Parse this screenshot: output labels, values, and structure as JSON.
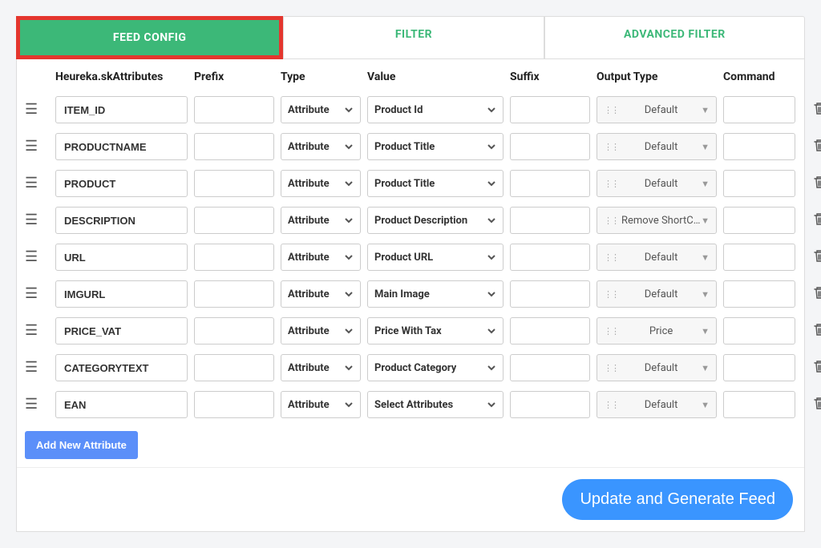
{
  "tabs": {
    "feed_config": "FEED CONFIG",
    "filter": "FILTER",
    "advanced_filter": "ADVANCED FILTER"
  },
  "columns": {
    "attributes": "Heureka.skAttributes",
    "prefix": "Prefix",
    "type": "Type",
    "value": "Value",
    "suffix": "Suffix",
    "output_type": "Output Type",
    "command": "Command"
  },
  "rows": [
    {
      "attr": "ITEM_ID",
      "prefix": "",
      "type": "Attribute",
      "value": "Product Id",
      "suffix": "",
      "output": "Default",
      "command": ""
    },
    {
      "attr": "PRODUCTNAME",
      "prefix": "",
      "type": "Attribute",
      "value": "Product Title",
      "suffix": "",
      "output": "Default",
      "command": ""
    },
    {
      "attr": "PRODUCT",
      "prefix": "",
      "type": "Attribute",
      "value": "Product Title",
      "suffix": "",
      "output": "Default",
      "command": ""
    },
    {
      "attr": "DESCRIPTION",
      "prefix": "",
      "type": "Attribute",
      "value": "Product Description",
      "suffix": "",
      "output": "Remove ShortC...",
      "command": ""
    },
    {
      "attr": "URL",
      "prefix": "",
      "type": "Attribute",
      "value": "Product URL",
      "suffix": "",
      "output": "Default",
      "command": ""
    },
    {
      "attr": "IMGURL",
      "prefix": "",
      "type": "Attribute",
      "value": "Main Image",
      "suffix": "",
      "output": "Default",
      "command": ""
    },
    {
      "attr": "PRICE_VAT",
      "prefix": "",
      "type": "Attribute",
      "value": "Price With Tax",
      "suffix": "",
      "output": "Price",
      "command": ""
    },
    {
      "attr": "CATEGORYTEXT",
      "prefix": "",
      "type": "Attribute",
      "value": "Product Category",
      "suffix": "",
      "output": "Default",
      "command": ""
    },
    {
      "attr": "EAN",
      "prefix": "",
      "type": "Attribute",
      "value": "Select Attributes",
      "suffix": "",
      "output": "Default",
      "command": ""
    }
  ],
  "buttons": {
    "add_attribute": "Add New Attribute",
    "update_feed": "Update and Generate Feed"
  }
}
